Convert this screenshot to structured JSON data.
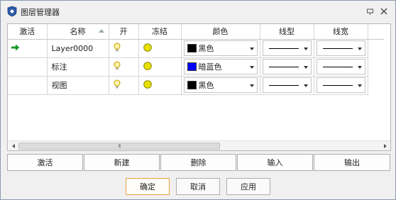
{
  "window": {
    "title": "图层管理器",
    "icons": {
      "app": "layer-manager-icon",
      "pin": "pin-icon",
      "close": "close-icon"
    }
  },
  "grid": {
    "columns": [
      "激活",
      "名称",
      "开",
      "冻结",
      "颜色",
      "线型",
      "线宽"
    ],
    "rows": [
      {
        "active": true,
        "active_icon": "green-arrow-icon",
        "name": "Layer0000",
        "on_icon": "lightbulb-icon",
        "freeze_icon": "sun-icon",
        "color_name": "黑色",
        "color_hex": "#000000"
      },
      {
        "active": false,
        "name": "标注",
        "on_icon": "lightbulb-icon",
        "freeze_icon": "sun-icon",
        "color_name": "暗蓝色",
        "color_hex": "#0000ff"
      },
      {
        "active": false,
        "name": "视图",
        "on_icon": "lightbulb-icon",
        "freeze_icon": "sun-icon",
        "color_name": "黑色",
        "color_hex": "#000000"
      }
    ],
    "scroll_thumb_label": "III"
  },
  "actions": [
    "激活",
    "新建",
    "删除",
    "输入",
    "输出"
  ],
  "dialog_buttons": {
    "ok": "确定",
    "cancel": "取消",
    "apply": "应用"
  },
  "colors": {
    "accent_default": "#e8a040",
    "active_arrow": "#1a9a2a",
    "bulb": "#e6c000",
    "sun": "#d8d000"
  }
}
